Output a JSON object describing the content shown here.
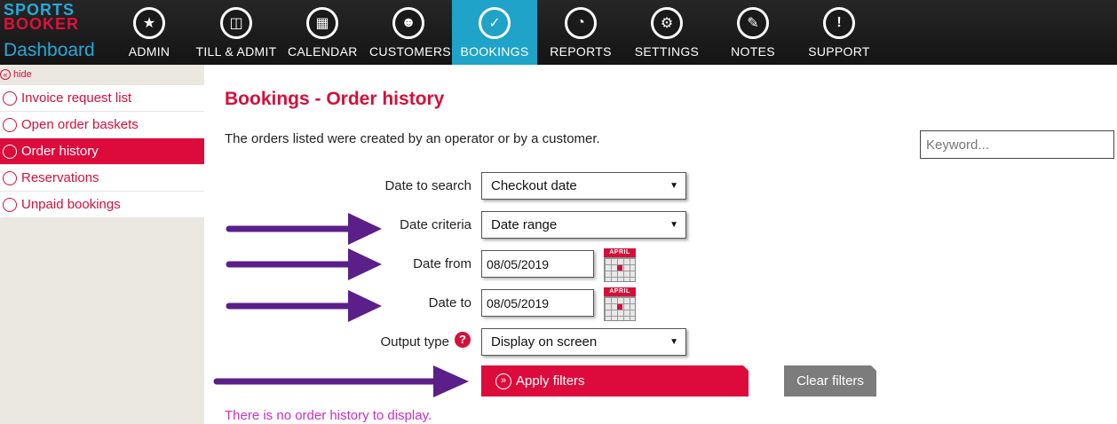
{
  "logo": {
    "sports": "SPORTS",
    "booker": "BOOKER",
    "dashboard": "Dashboard"
  },
  "nav": {
    "items": [
      {
        "label": "ADMIN",
        "icon": "medal-icon"
      },
      {
        "label": "TILL & ADMIT",
        "icon": "gate-icon"
      },
      {
        "label": "CALENDAR",
        "icon": "calendar-icon"
      },
      {
        "label": "CUSTOMERS",
        "icon": "person-icon"
      },
      {
        "label": "BOOKINGS",
        "icon": "check-icon",
        "active": true
      },
      {
        "label": "REPORTS",
        "icon": "pie-chart-icon"
      },
      {
        "label": "SETTINGS",
        "icon": "gear-icon"
      },
      {
        "label": "NOTES",
        "icon": "note-icon"
      },
      {
        "label": "SUPPORT",
        "icon": "exclamation-icon"
      }
    ]
  },
  "sidebar": {
    "hide_label": "hide",
    "items": [
      {
        "label": "Invoice request list"
      },
      {
        "label": "Open order baskets"
      },
      {
        "label": "Order history",
        "active": true
      },
      {
        "label": "Reservations"
      },
      {
        "label": "Unpaid bookings"
      }
    ]
  },
  "main": {
    "title": "Bookings - Order history",
    "intro": "The orders listed were created by an operator or by a customer.",
    "keyword_placeholder": "Keyword...",
    "filters": {
      "date_to_search": {
        "label": "Date to search",
        "value": "Checkout date"
      },
      "date_criteria": {
        "label": "Date criteria",
        "value": "Date range"
      },
      "date_from": {
        "label": "Date from",
        "value": "08/05/2019"
      },
      "date_to": {
        "label": "Date to",
        "value": "08/05/2019"
      },
      "output_type": {
        "label": "Output type",
        "value": "Display on screen"
      }
    },
    "calendar_month": "APRIL",
    "help_glyph": "?",
    "apply_label": "Apply filters",
    "clear_label": "Clear filters",
    "empty_message": "There is no order history to display."
  },
  "colors": {
    "brand_red": "#dd0b3c",
    "active_blue": "#1fa3c8",
    "annotation_arrow": "#5b1f8a",
    "message_magenta": "#c930c4"
  }
}
